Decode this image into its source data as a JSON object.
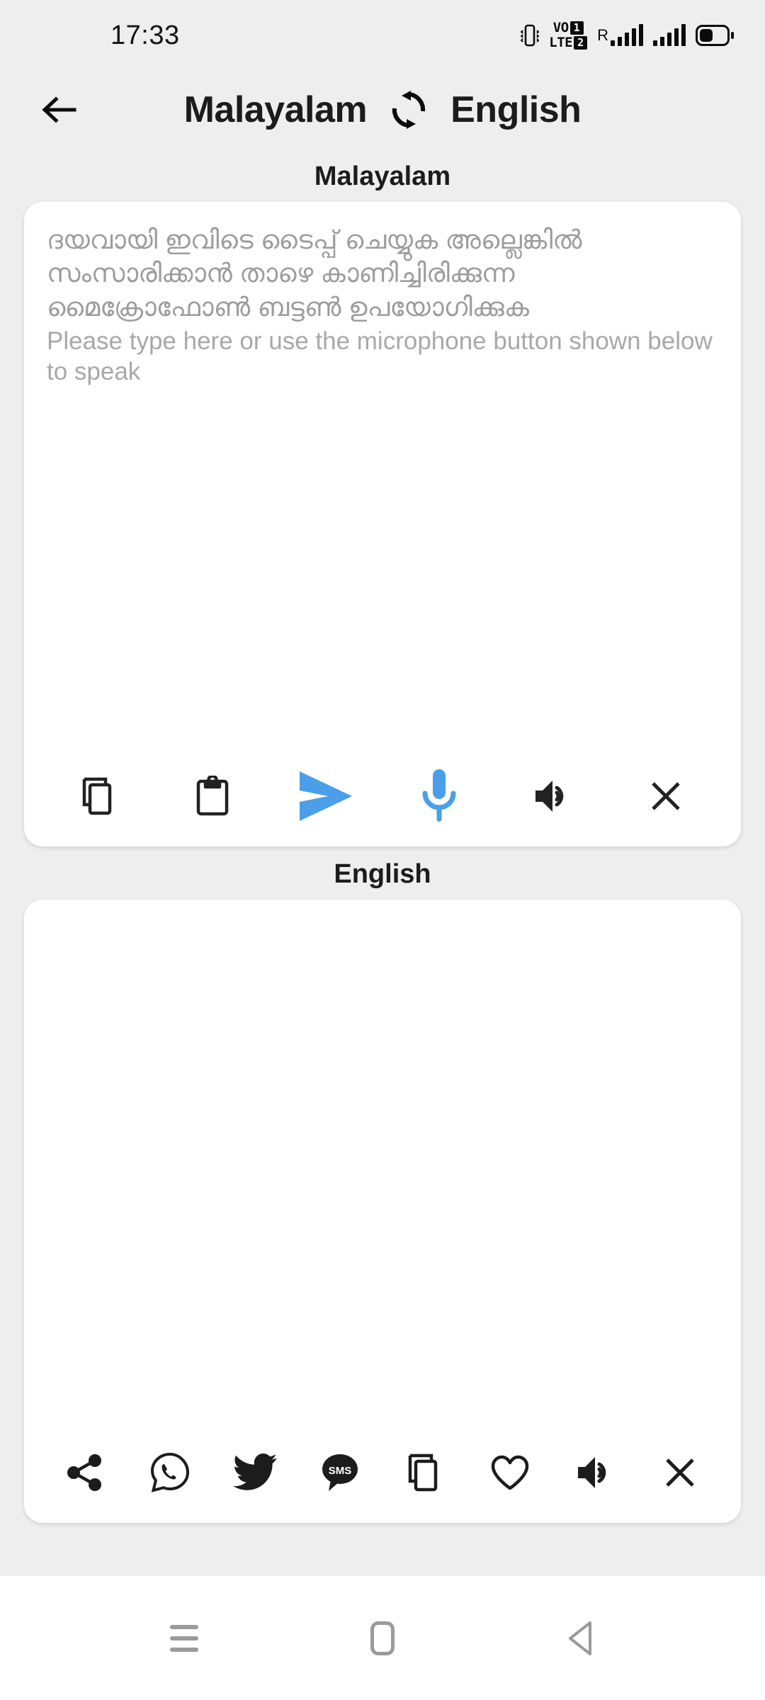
{
  "status_bar": {
    "time": "17:33",
    "icons": [
      "vibrate-icon",
      "volte-dual-sim-icon",
      "roaming-signal-icon",
      "signal-icon",
      "battery-icon"
    ],
    "volte_label": "VO",
    "volte_label2": "LTE",
    "sim1": "1",
    "sim2": "2",
    "roaming": "R",
    "battery_level": "40"
  },
  "header": {
    "back_icon": "arrow-left-icon",
    "source_language": "Malayalam",
    "swap_icon": "swap-languages-icon",
    "target_language": "English"
  },
  "source_section": {
    "label": "Malayalam",
    "placeholder_native": "ദയവായി ഇവിടെ ടൈപ്പ് ചെയ്യുക അല്ലെങ്കിൽ സംസാരിക്കാൻ താഴെ കാണിച്ചിരിക്കുന്ന മൈക്രോഫോൺ ബട്ടൺ ഉപയോഗിക്കുക",
    "placeholder_english": "Please type here or use the microphone button shown below to speak",
    "value": "",
    "toolbar": [
      {
        "name": "copy-button",
        "icon": "copy-icon",
        "label": "Copy",
        "color": "#222222"
      },
      {
        "name": "paste-button",
        "icon": "clipboard-icon",
        "label": "Paste",
        "color": "#222222"
      },
      {
        "name": "translate-send-button",
        "icon": "send-icon",
        "label": "Translate",
        "color": "#4a9fe8"
      },
      {
        "name": "microphone-button",
        "icon": "microphone-icon",
        "label": "Speak",
        "color": "#4a9fe8"
      },
      {
        "name": "speak-aloud-button",
        "icon": "speaker-icon",
        "label": "Listen",
        "color": "#222222"
      },
      {
        "name": "clear-button",
        "icon": "close-icon",
        "label": "Clear",
        "color": "#222222"
      }
    ]
  },
  "target_section": {
    "label": "English",
    "value": "",
    "toolbar": [
      {
        "name": "share-button",
        "icon": "share-icon",
        "label": "Share",
        "color": "#1c1c1c"
      },
      {
        "name": "whatsapp-button",
        "icon": "whatsapp-icon",
        "label": "WhatsApp",
        "color": "#1c1c1c"
      },
      {
        "name": "twitter-button",
        "icon": "twitter-icon",
        "label": "Twitter",
        "color": "#1c1c1c"
      },
      {
        "name": "sms-button",
        "icon": "sms-icon",
        "label": "SMS",
        "color": "#1c1c1c"
      },
      {
        "name": "copy-button",
        "icon": "copy-icon",
        "label": "Copy",
        "color": "#1c1c1c"
      },
      {
        "name": "favorite-button",
        "icon": "heart-icon",
        "label": "Favorite",
        "color": "#1c1c1c"
      },
      {
        "name": "speak-aloud-button",
        "icon": "speaker-icon",
        "label": "Listen",
        "color": "#1c1c1c"
      },
      {
        "name": "clear-button",
        "icon": "close-icon",
        "label": "Clear",
        "color": "#1c1c1c"
      }
    ]
  },
  "nav_bar": {
    "recents_icon": "recents-icon",
    "home_icon": "home-icon",
    "back_icon": "back-triangle-icon"
  },
  "colors": {
    "background": "#eeeeee",
    "card": "#ffffff",
    "accent": "#4a9fe8",
    "text_primary": "#1c1c1c",
    "placeholder": "#9c9c9c",
    "nav_icon": "#9a9a9a"
  }
}
